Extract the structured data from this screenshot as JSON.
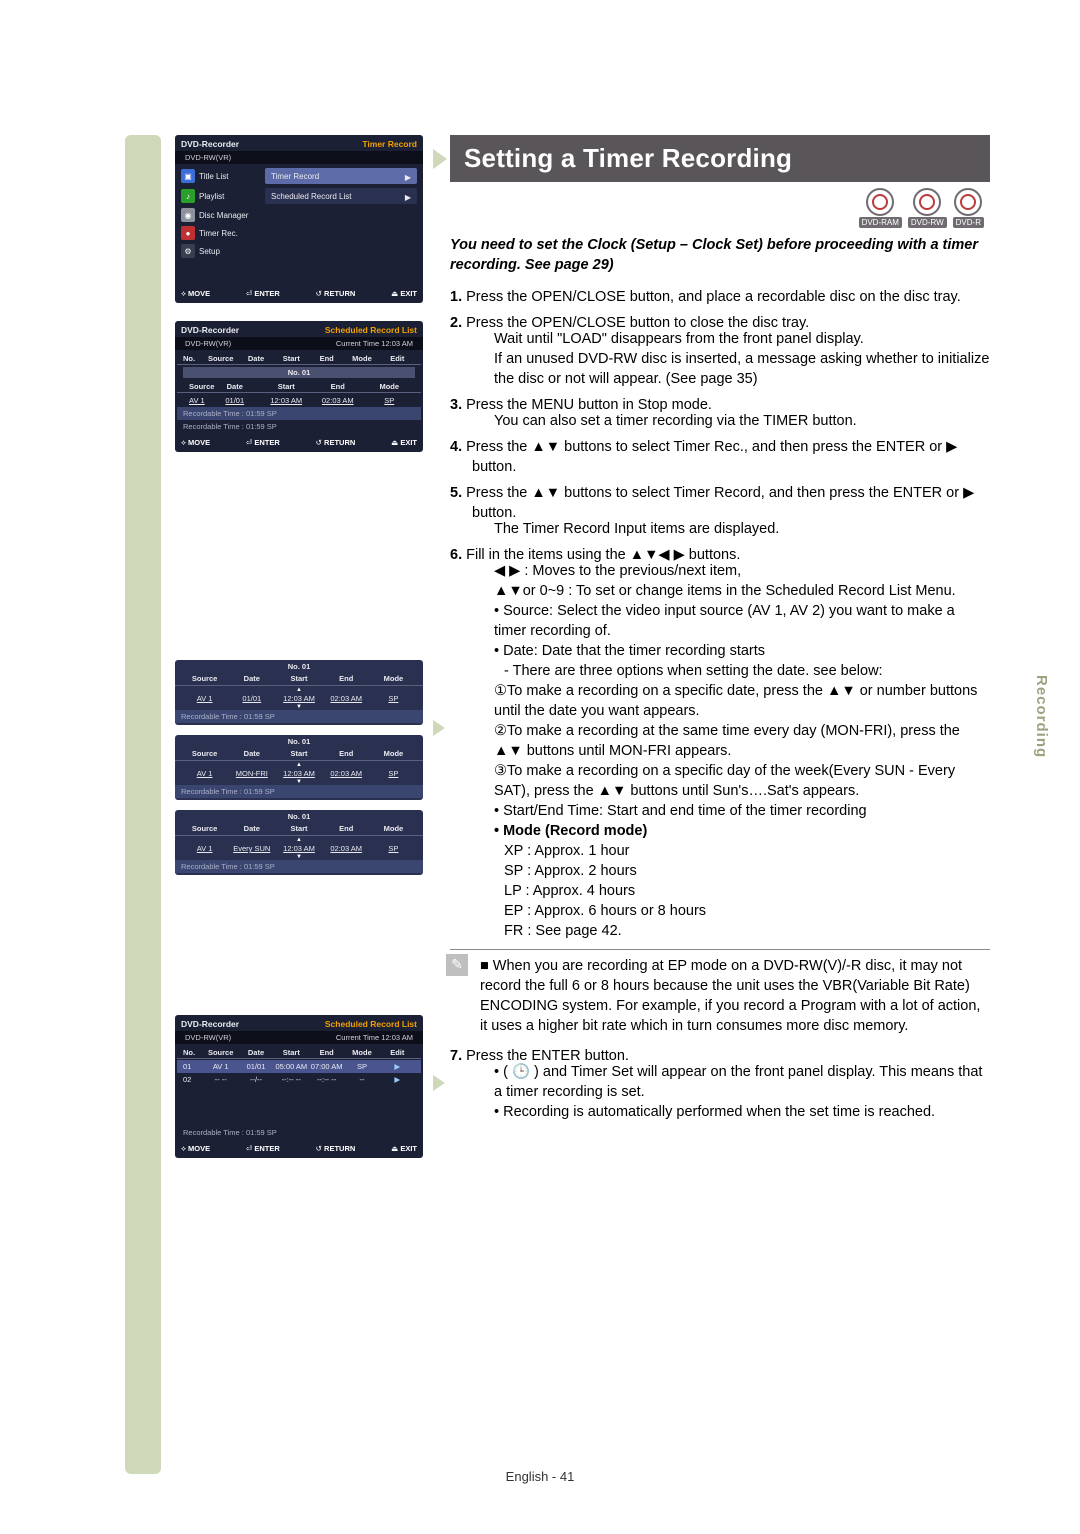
{
  "section_title": "Setting a Timer Recording",
  "side_label": "Recording",
  "footer": "English - 41",
  "badges": [
    "DVD-RAM",
    "DVD-RW",
    "DVD-R"
  ],
  "lead_text": "You need to set the Clock (Setup – Clock Set) before proceeding with a timer recording. See page 29)",
  "steps": {
    "s1": {
      "n": "1.",
      "text": "Press the OPEN/CLOSE button, and place a recordable disc on the disc tray."
    },
    "s2": {
      "n": "2.",
      "l1": "Press the OPEN/CLOSE button to close the disc tray.",
      "l2": "Wait until \"LOAD\" disappears from the front panel display.",
      "l3": "If an unused DVD-RW disc is inserted, a message asking whether to initialize the disc or not will appear. (See page 35)"
    },
    "s3": {
      "n": "3.",
      "l1": "Press the MENU button in Stop mode.",
      "l2": "You can also set a timer recording via the TIMER button."
    },
    "s4": {
      "n": "4.",
      "text": "Press the ▲▼ buttons to select Timer Rec., and then press the ENTER or ▶ button."
    },
    "s5": {
      "n": "5.",
      "l1": "Press the ▲▼ buttons to select Timer Record, and then press the ENTER or ▶ button.",
      "l2": "The Timer Record Input items are displayed."
    },
    "s6": {
      "n": "6.",
      "l1": "Fill in the items using the ▲▼◀ ▶ buttons.",
      "b1": "◀ ▶ : Moves to the previous/next item,",
      "b2": "▲▼or 0~9 : To set or change items in the Scheduled Record List Menu.",
      "b3": "• Source: Select the video input source (AV 1, AV 2)  you want to make a timer recording of.",
      "b4": "• Date: Date that the timer recording starts",
      "b4a": "- There are three options when setting the date. see below:",
      "c1": "①To make a recording on a specific date, press the ▲▼ or number buttons until the date you want appears.",
      "c2": "②To make a recording at the same time every day (MON-FRI), press the ▲▼ buttons until MON-FRI appears.",
      "c3": "③To make a recording on a specific day of the week(Every SUN - Every SAT), press the ▲▼ buttons until Sun's….Sat's appears.",
      "b5": "• Start/End Time: Start and end time of the timer recording",
      "b6": "• Mode (Record mode)",
      "m1": "XP : Approx. 1 hour",
      "m2": "SP : Approx. 2 hours",
      "m3": "LP : Approx. 4 hours",
      "m4": "EP : Approx. 6 hours or 8 hours",
      "m5": "FR : See page 42."
    },
    "note": "When you are recording at EP mode on a DVD-RW(V)/-R disc, it may not record the full 6 or 8 hours because the unit uses the VBR(Variable Bit Rate) ENCODING system. For example, if you record a Program with a lot of action, it uses a higher bit rate which in turn consumes more disc memory.",
    "s7": {
      "n": "7.",
      "l1": "Press the ENTER button.",
      "b1": "• ( 🕒 ) and Timer Set will appear on the front panel display. This means that a timer recording is set.",
      "b2": "• Recording is automatically performed when the set time is reached."
    }
  },
  "osd1": {
    "title_left": "DVD-Recorder",
    "title_right": "Timer Record",
    "sub": "DVD-RW(VR)",
    "menu": [
      {
        "icon": "blue",
        "label": "Title List",
        "right": ""
      },
      {
        "icon": "green",
        "label": "Playlist",
        "right": ""
      },
      {
        "icon": "grey",
        "label": "Disc Manager",
        "right": ""
      },
      {
        "icon": "red",
        "label": "Timer Rec.",
        "right": "Timer Record",
        "hl": true,
        "right2": "Scheduled Record List"
      },
      {
        "icon": "dark",
        "label": "Setup",
        "right": ""
      }
    ],
    "footer": {
      "move": "MOVE",
      "enter": "ENTER",
      "ret": "RETURN",
      "exit": "EXIT"
    }
  },
  "osd2": {
    "title_left": "DVD-Recorder",
    "title_right": "Scheduled Record List",
    "sub_left": "DVD-RW(VR)",
    "sub_right": "Current Time  12:03 AM",
    "cols": [
      "No.",
      "Source",
      "Date",
      "Start",
      "End",
      "Mode",
      "Edit"
    ],
    "num_title": "No. 01",
    "cols2": [
      "Source",
      "Date",
      "Start",
      "End",
      "Mode"
    ],
    "row": [
      "AV 1",
      "01/01",
      "12:03 AM",
      "02:03 AM",
      "SP"
    ],
    "rec": "Recordable Time : 01:59  SP",
    "rec2": "Recordable Time : 01:59  SP",
    "footer": {
      "move": "MOVE",
      "enter": "ENTER",
      "ret": "RETURN",
      "exit": "EXIT"
    }
  },
  "mini": [
    {
      "title": "No. 01",
      "cols": [
        "Source",
        "Date",
        "Start",
        "End",
        "Mode"
      ],
      "row": [
        "AV 1",
        "01/01",
        "12:03 AM",
        "02:03 AM",
        "SP"
      ],
      "rec": "Recordable Time : 01:59  SP"
    },
    {
      "title": "No. 01",
      "cols": [
        "Source",
        "Date",
        "Start",
        "End",
        "Mode"
      ],
      "row": [
        "AV 1",
        "MON-FRI",
        "12:03 AM",
        "02:03 AM",
        "SP"
      ],
      "rec": "Recordable Time : 01:59  SP"
    },
    {
      "title": "No. 01",
      "cols": [
        "Source",
        "Date",
        "Start",
        "End",
        "Mode"
      ],
      "row": [
        "AV 1",
        "Every SUN",
        "12:03 AM",
        "02:03 AM",
        "SP"
      ],
      "rec": "Recordable Time : 01:59  SP"
    }
  ],
  "osd3": {
    "title_left": "DVD-Recorder",
    "title_right": "Scheduled Record List",
    "sub_left": "DVD-RW(VR)",
    "sub_right": "Current Time  12:03 AM",
    "cols": [
      "No.",
      "Source",
      "Date",
      "Start",
      "End",
      "Mode",
      "Edit"
    ],
    "rows": [
      [
        "01",
        "AV 1",
        "01/01",
        "05:00 AM",
        "07:00 AM",
        "SP",
        "▶"
      ],
      [
        "02",
        "-- --",
        "--/--",
        "--:-- --",
        "--:-- --",
        "--",
        "▶"
      ]
    ],
    "rec": "Recordable Time :  01:59  SP",
    "footer": {
      "move": "MOVE",
      "enter": "ENTER",
      "ret": "RETURN",
      "exit": "EXIT"
    }
  }
}
